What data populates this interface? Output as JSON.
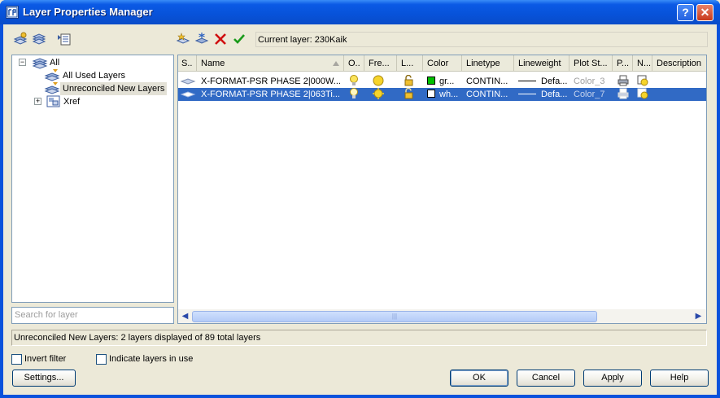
{
  "window": {
    "title": "Layer Properties Manager",
    "help_glyph": "?",
    "close_glyph": "✕"
  },
  "toolbar": {
    "current_layer_text": "Current layer: 230Kaik"
  },
  "tree": {
    "root": "All",
    "items": [
      "All Used Layers",
      "Unreconciled New Layers",
      "Xref"
    ],
    "selected": "Unreconciled New Layers",
    "collapse_glyph": "−",
    "expand_glyph": "+"
  },
  "search": {
    "placeholder": "Search for layer"
  },
  "grid": {
    "columns": [
      "S..",
      "Name",
      "O..",
      "Fre...",
      "L...",
      "Color",
      "Linetype",
      "Lineweight",
      "Plot St...",
      "P...",
      "N...",
      "Description"
    ],
    "rows": [
      {
        "name": "X-FORMAT-PSR PHASE 2|000W...",
        "color_name": "gr...",
        "color_hex": "#00c000",
        "linetype": "CONTIN...",
        "lineweight": "Defa...",
        "plot_style": "Color_3",
        "selected": false
      },
      {
        "name": "X-FORMAT-PSR PHASE 2|063Ti...",
        "color_name": "wh...",
        "color_hex": "#ffffff",
        "linetype": "CONTIN...",
        "lineweight": "Defa...",
        "plot_style": "Color_7",
        "selected": true
      }
    ],
    "scroll_left": "◀",
    "scroll_right": "▶",
    "thumb_grip": "|||"
  },
  "status": {
    "text": "Unreconciled New Layers: 2 layers displayed of 89 total layers"
  },
  "options": {
    "invert_filter": "Invert filter",
    "indicate_layers": "Indicate layers in use"
  },
  "buttons": {
    "settings": "Settings...",
    "ok": "OK",
    "cancel": "Cancel",
    "apply": "Apply",
    "help": "Help"
  },
  "colors": {
    "titlebar": "#0b5ae5",
    "selection": "#316ac5",
    "dialog_bg": "#ece9d8"
  }
}
